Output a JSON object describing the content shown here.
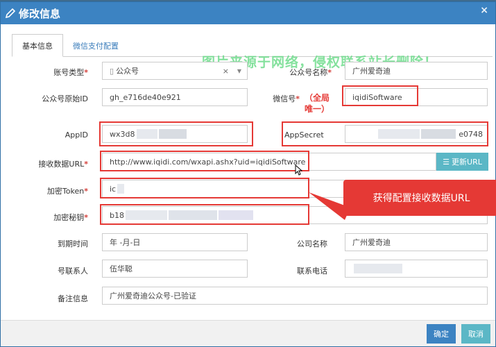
{
  "dialog": {
    "title": "修改信息",
    "close_glyph": "×"
  },
  "watermark": "图片来源于网络，侵权联系站长删除！",
  "tabs": [
    {
      "label": "基本信息"
    },
    {
      "label": "微信支付配置"
    }
  ],
  "form": {
    "account_type": {
      "label": "账号类型",
      "value": "公众号",
      "clear": "×"
    },
    "public_name": {
      "label": "公众号名称",
      "value": "广州爱奇迪"
    },
    "original_id": {
      "label": "公众号原始ID",
      "value": "gh_e716de40e921"
    },
    "wechat_id": {
      "label": "微信号",
      "value": "iqidiSoftware",
      "note": "（全局唯一）"
    },
    "appid": {
      "label": "AppID",
      "value": "wx3d8"
    },
    "appsecret": {
      "label": "AppSecret",
      "value": "e0748"
    },
    "receive_url": {
      "label": "接收数据URL",
      "value": "http://www.iqidi.com/wxapi.ashx?uid=iqidiSoftware"
    },
    "token": {
      "label": "加密Token",
      "value": "ic"
    },
    "aes_key": {
      "label": "加密秘钥",
      "value": "b18"
    },
    "expire": {
      "label": "到期时间",
      "value": "年 -月-日"
    },
    "company": {
      "label": "公司名称",
      "value": "广州爱奇迪"
    },
    "contact": {
      "label": "号联系人",
      "value": "伍华聪"
    },
    "phone": {
      "label": "联系电话",
      "value": ""
    },
    "remark": {
      "label": "备注信息",
      "value": "广州爱奇迪公众号-已验证"
    }
  },
  "refresh_button": "更新URL",
  "callout": "获得配置接收数据URL",
  "footer": {
    "ok": "确定",
    "cancel": "取消"
  },
  "colors": {
    "title_bar": "#3c83c2",
    "highlight": "#e53935",
    "accent_cyan": "#5bb7c6",
    "watermark": "#6fdc8c"
  }
}
